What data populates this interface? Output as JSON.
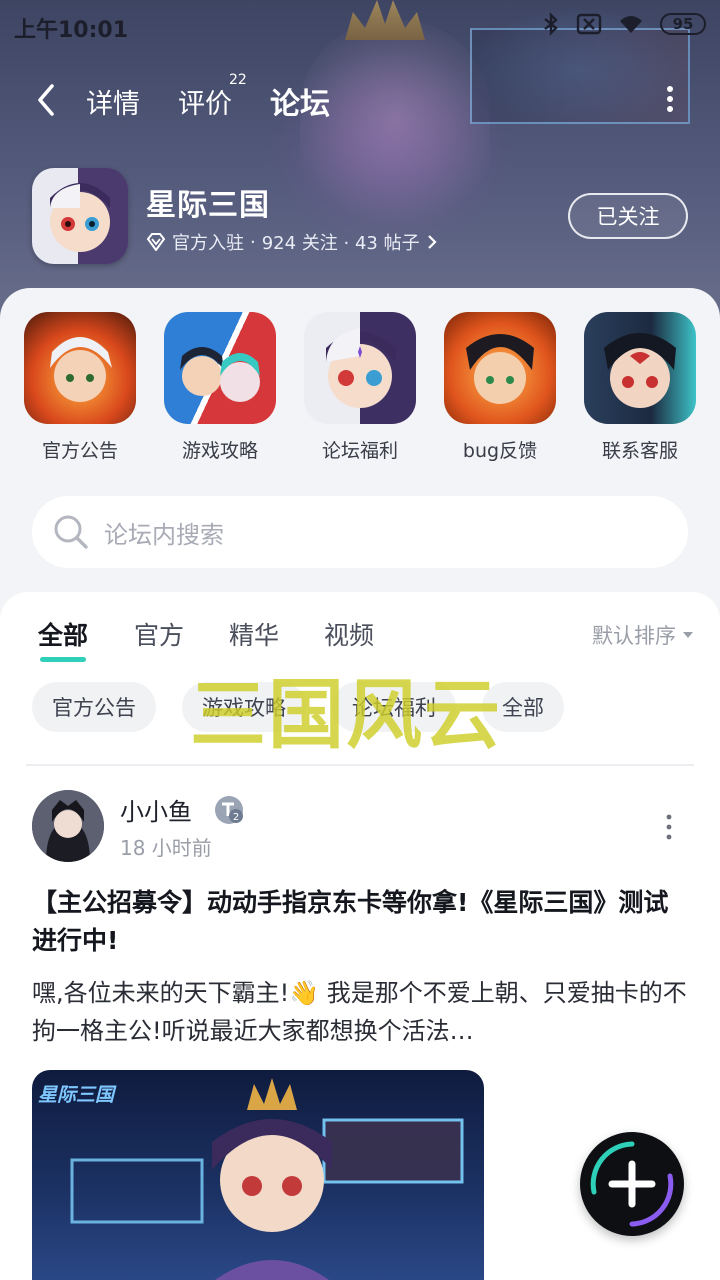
{
  "status_bar": {
    "time": "上午10:01",
    "battery": "95",
    "icons": [
      "bluetooth-icon",
      "sim-off-icon",
      "wifi-icon",
      "battery-icon"
    ]
  },
  "nav": {
    "tabs": [
      {
        "label": "详情"
      },
      {
        "label": "评价",
        "badge": "22"
      },
      {
        "label": "论坛"
      }
    ],
    "active_tab": "论坛",
    "accent_color": "#2fd0b9"
  },
  "game": {
    "name": "星际三国",
    "official_label": "官方入驻",
    "stats": "924 关注 · 43 帖子",
    "follow_label": "已关注"
  },
  "shortcuts": [
    {
      "label": "官方公告"
    },
    {
      "label": "游戏攻略"
    },
    {
      "label": "论坛福利"
    },
    {
      "label": "bug反馈"
    },
    {
      "label": "联系客服"
    }
  ],
  "search": {
    "placeholder": "论坛内搜索"
  },
  "feed": {
    "tabs": [
      "全部",
      "官方",
      "精华",
      "视频"
    ],
    "active_tab": "全部",
    "sort_label": "默认排序",
    "chips": [
      "官方公告",
      "游戏攻略",
      "论坛福利",
      "全部"
    ],
    "overlay_text": "三国风云"
  },
  "post": {
    "author": "小小鱼",
    "level": "2",
    "time": "18 小时前",
    "title": "【主公招募令】动动手指京东卡等你拿!《星际三国》测试进行中!",
    "body": "嘿,各位未来的天下霸主!👋 我是那个不爱上朝、只爱抽卡的不拘一格主公!听说最近大家都想换个活法…",
    "image_caption": "星际三国"
  }
}
